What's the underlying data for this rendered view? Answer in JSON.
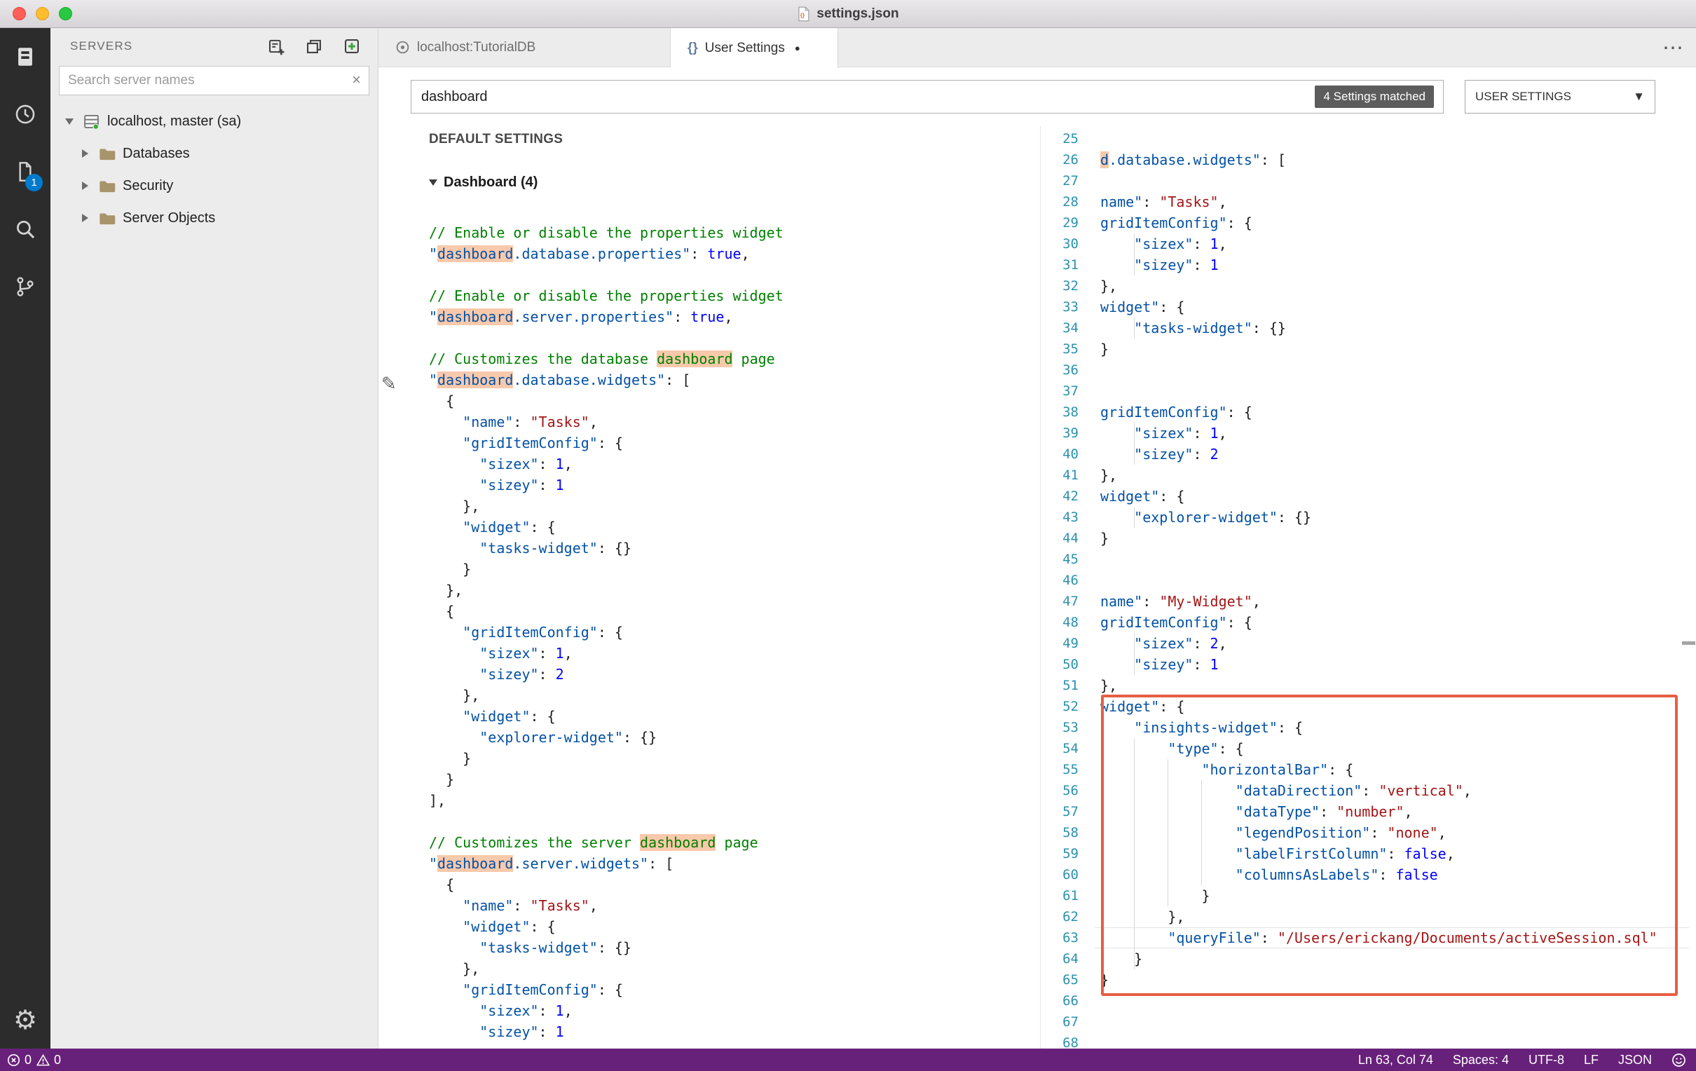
{
  "window": {
    "title": "settings.json"
  },
  "activity_bar": {
    "badge": "1",
    "items": [
      "servers",
      "task-history",
      "running-tasks",
      "search",
      "source-control",
      "settings"
    ]
  },
  "sidebar": {
    "header": "SERVERS",
    "search": {
      "placeholder": "Search server names"
    },
    "tree": [
      {
        "label": "localhost, master (sa)",
        "icon": "server",
        "expanded": true,
        "level": 0
      },
      {
        "label": "Databases",
        "icon": "folder",
        "expanded": false,
        "level": 1
      },
      {
        "label": "Security",
        "icon": "folder",
        "expanded": false,
        "level": 1
      },
      {
        "label": "Server Objects",
        "icon": "folder",
        "expanded": false,
        "level": 1
      }
    ]
  },
  "editor": {
    "tabs": [
      {
        "label": "localhost:TutorialDB",
        "active": false,
        "dirty": false
      },
      {
        "label": "User Settings",
        "active": true,
        "dirty": true
      }
    ],
    "settings_bar": {
      "query": "dashboard",
      "matches": "4 Settings matched",
      "scope": "USER SETTINGS"
    },
    "default_settings": {
      "heading": "DEFAULT SETTINGS",
      "group": "Dashboard (4)",
      "lines": [
        [
          [
            "// Enable or disable the properties widget",
            "cm"
          ]
        ],
        [
          [
            "\"",
            "k"
          ],
          [
            "dashboard",
            "k",
            "hl"
          ],
          [
            ".database.properties\"",
            "k"
          ],
          [
            ": ",
            "p"
          ],
          [
            "true",
            "b"
          ],
          [
            ",",
            "p"
          ]
        ],
        [],
        [
          [
            "// Enable or disable the properties widget",
            "cm"
          ]
        ],
        [
          [
            "\"",
            "k"
          ],
          [
            "dashboard",
            "k",
            "hl"
          ],
          [
            ".server.properties\"",
            "k"
          ],
          [
            ": ",
            "p"
          ],
          [
            "true",
            "b"
          ],
          [
            ",",
            "p"
          ]
        ],
        [],
        [
          [
            "// Customizes the database ",
            "cm"
          ],
          [
            "dashboard",
            "cm",
            "hl"
          ],
          [
            " page",
            "cm"
          ]
        ],
        [
          [
            "\"",
            "k"
          ],
          [
            "dashboard",
            "k",
            "hl"
          ],
          [
            ".database.widgets\"",
            "k"
          ],
          [
            ": [",
            "p"
          ]
        ],
        [
          [
            "  {",
            "p"
          ]
        ],
        [
          [
            "    \"name\"",
            "k"
          ],
          [
            ": ",
            "p"
          ],
          [
            "\"Tasks\"",
            "s"
          ],
          [
            ",",
            "p"
          ]
        ],
        [
          [
            "    \"gridItemConfig\"",
            "k"
          ],
          [
            ": {",
            "p"
          ]
        ],
        [
          [
            "      \"sizex\"",
            "k"
          ],
          [
            ": ",
            "p"
          ],
          [
            "1",
            "n"
          ],
          [
            ",",
            "p"
          ]
        ],
        [
          [
            "      \"sizey\"",
            "k"
          ],
          [
            ": ",
            "p"
          ],
          [
            "1",
            "n"
          ]
        ],
        [
          [
            "    },",
            "p"
          ]
        ],
        [
          [
            "    \"widget\"",
            "k"
          ],
          [
            ": {",
            "p"
          ]
        ],
        [
          [
            "      \"tasks-widget\"",
            "k"
          ],
          [
            ": {}",
            "p"
          ]
        ],
        [
          [
            "    }",
            "p"
          ]
        ],
        [
          [
            "  },",
            "p"
          ]
        ],
        [
          [
            "  {",
            "p"
          ]
        ],
        [
          [
            "    \"gridItemConfig\"",
            "k"
          ],
          [
            ": {",
            "p"
          ]
        ],
        [
          [
            "      \"sizex\"",
            "k"
          ],
          [
            ": ",
            "p"
          ],
          [
            "1",
            "n"
          ],
          [
            ",",
            "p"
          ]
        ],
        [
          [
            "      \"sizey\"",
            "k"
          ],
          [
            ": ",
            "p"
          ],
          [
            "2",
            "n"
          ]
        ],
        [
          [
            "    },",
            "p"
          ]
        ],
        [
          [
            "    \"widget\"",
            "k"
          ],
          [
            ": {",
            "p"
          ]
        ],
        [
          [
            "      \"explorer-widget\"",
            "k"
          ],
          [
            ": {}",
            "p"
          ]
        ],
        [
          [
            "    }",
            "p"
          ]
        ],
        [
          [
            "  }",
            "p"
          ]
        ],
        [
          [
            "],",
            "p"
          ]
        ],
        [],
        [
          [
            "// Customizes the server ",
            "cm"
          ],
          [
            "dashboard",
            "cm",
            "hl"
          ],
          [
            " page",
            "cm"
          ]
        ],
        [
          [
            "\"",
            "k"
          ],
          [
            "dashboard",
            "k",
            "hl"
          ],
          [
            ".server.widgets\"",
            "k"
          ],
          [
            ": [",
            "p"
          ]
        ],
        [
          [
            "  {",
            "p"
          ]
        ],
        [
          [
            "    \"name\"",
            "k"
          ],
          [
            ": ",
            "p"
          ],
          [
            "\"Tasks\"",
            "s"
          ],
          [
            ",",
            "p"
          ]
        ],
        [
          [
            "    \"widget\"",
            "k"
          ],
          [
            ": {",
            "p"
          ]
        ],
        [
          [
            "      \"tasks-widget\"",
            "k"
          ],
          [
            ": {}",
            "p"
          ]
        ],
        [
          [
            "    },",
            "p"
          ]
        ],
        [
          [
            "    \"gridItemConfig\"",
            "k"
          ],
          [
            ": {",
            "p"
          ]
        ],
        [
          [
            "      \"sizex\"",
            "k"
          ],
          [
            ": ",
            "p"
          ],
          [
            "1",
            "n"
          ],
          [
            ",",
            "p"
          ]
        ],
        [
          [
            "      \"sizey\"",
            "k"
          ],
          [
            ": ",
            "p"
          ],
          [
            "1",
            "n"
          ]
        ]
      ]
    },
    "user_settings": {
      "first_line": 25,
      "lines": [
        [],
        [
          [
            "d",
            "k",
            "hl"
          ],
          [
            ".database.widgets\"",
            "k"
          ],
          [
            ": [",
            "p"
          ]
        ],
        [],
        [
          [
            "name\"",
            "k"
          ],
          [
            ": ",
            "p"
          ],
          [
            "\"Tasks\"",
            "s"
          ],
          [
            ",",
            "p"
          ]
        ],
        [
          [
            "gridItemConfig\"",
            "k"
          ],
          [
            ": {",
            "p"
          ]
        ],
        [
          [
            "    \"sizex\"",
            "k"
          ],
          [
            ": ",
            "p"
          ],
          [
            "1",
            "n"
          ],
          [
            ",",
            "p"
          ]
        ],
        [
          [
            "    \"sizey\"",
            "k"
          ],
          [
            ": ",
            "p"
          ],
          [
            "1",
            "n"
          ]
        ],
        [
          [
            "},",
            "p"
          ]
        ],
        [
          [
            "widget\"",
            "k"
          ],
          [
            ": {",
            "p"
          ]
        ],
        [
          [
            "    \"tasks-widget\"",
            "k"
          ],
          [
            ": {}",
            "p"
          ]
        ],
        [
          [
            "}",
            "p"
          ]
        ],
        [],
        [],
        [
          [
            "gridItemConfig\"",
            "k"
          ],
          [
            ": {",
            "p"
          ]
        ],
        [
          [
            "    \"sizex\"",
            "k"
          ],
          [
            ": ",
            "p"
          ],
          [
            "1",
            "n"
          ],
          [
            ",",
            "p"
          ]
        ],
        [
          [
            "    \"sizey\"",
            "k"
          ],
          [
            ": ",
            "p"
          ],
          [
            "2",
            "n"
          ]
        ],
        [
          [
            "},",
            "p"
          ]
        ],
        [
          [
            "widget\"",
            "k"
          ],
          [
            ": {",
            "p"
          ]
        ],
        [
          [
            "    \"explorer-widget\"",
            "k"
          ],
          [
            ": {}",
            "p"
          ]
        ],
        [
          [
            "}",
            "p"
          ]
        ],
        [],
        [],
        [
          [
            "name\"",
            "k"
          ],
          [
            ": ",
            "p"
          ],
          [
            "\"My-Widget\"",
            "s"
          ],
          [
            ",",
            "p"
          ]
        ],
        [
          [
            "gridItemConfig\"",
            "k"
          ],
          [
            ": {",
            "p"
          ]
        ],
        [
          [
            "    \"sizex\"",
            "k"
          ],
          [
            ": ",
            "p"
          ],
          [
            "2",
            "n"
          ],
          [
            ",",
            "p"
          ]
        ],
        [
          [
            "    \"sizey\"",
            "k"
          ],
          [
            ": ",
            "p"
          ],
          [
            "1",
            "n"
          ]
        ],
        [
          [
            "},",
            "p"
          ]
        ],
        [
          [
            "widget\"",
            "k"
          ],
          [
            ": {",
            "p"
          ]
        ],
        [
          [
            "    \"insights-widget\"",
            "k"
          ],
          [
            ": {",
            "p"
          ]
        ],
        [
          [
            "        \"type\"",
            "k"
          ],
          [
            ": {",
            "p"
          ]
        ],
        [
          [
            "            \"horizontalBar\"",
            "k"
          ],
          [
            ": {",
            "p"
          ]
        ],
        [
          [
            "                \"dataDirection\"",
            "k"
          ],
          [
            ": ",
            "p"
          ],
          [
            "\"vertical\"",
            "s"
          ],
          [
            ",",
            "p"
          ]
        ],
        [
          [
            "                \"dataType\"",
            "k"
          ],
          [
            ": ",
            "p"
          ],
          [
            "\"number\"",
            "s"
          ],
          [
            ",",
            "p"
          ]
        ],
        [
          [
            "                \"legendPosition\"",
            "k"
          ],
          [
            ": ",
            "p"
          ],
          [
            "\"none\"",
            "s"
          ],
          [
            ",",
            "p"
          ]
        ],
        [
          [
            "                \"labelFirstColumn\"",
            "k"
          ],
          [
            ": ",
            "p"
          ],
          [
            "false",
            "b"
          ],
          [
            ",",
            "p"
          ]
        ],
        [
          [
            "                \"columnsAsLabels\"",
            "k"
          ],
          [
            ": ",
            "p"
          ],
          [
            "false",
            "b"
          ]
        ],
        [
          [
            "            }",
            "p"
          ]
        ],
        [
          [
            "        },",
            "p"
          ]
        ],
        [
          [
            "        \"queryFile\"",
            "k"
          ],
          [
            ": ",
            "p"
          ],
          [
            "\"/Users/erickang/Documents/activeSession.sql\"",
            "s"
          ]
        ],
        [
          [
            "    }",
            "p"
          ]
        ],
        [
          [
            "}",
            "p"
          ]
        ],
        [],
        [],
        []
      ]
    }
  },
  "status_bar": {
    "errors": "0",
    "warnings": "0",
    "cursor": "Ln 63, Col 74",
    "indent": "Spaces: 4",
    "encoding": "UTF-8",
    "eol": "LF",
    "language": "JSON"
  },
  "colors": {
    "status_bar": "#68217a",
    "badge_accent": "#007acc",
    "annotation": "#e65f43",
    "match_highlight": "rgba(234,92,0,0.33)"
  }
}
